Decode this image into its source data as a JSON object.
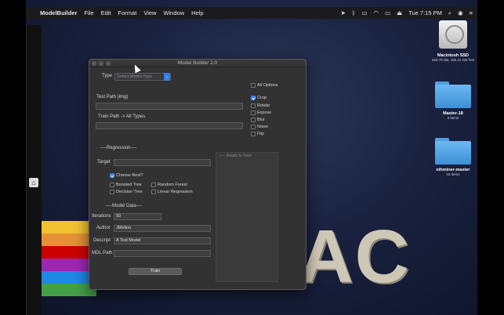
{
  "menubar": {
    "app": "ModelBuilder",
    "items": [
      "File",
      "Edit",
      "Format",
      "View",
      "Window",
      "Help"
    ],
    "clock": "Tue 7:15 PM"
  },
  "desktop": {
    "drive": {
      "label": "Macintosh SSD",
      "sub": "250.79 GB, 165.41 GB free"
    },
    "folders": [
      {
        "label": "Master-18",
        "sub": "5 items"
      },
      {
        "label": "ethminer-master",
        "sub": "16 items"
      }
    ],
    "wallpaper_text": "DMAC",
    "rainbow": [
      "#f1c232",
      "#e69138",
      "#cc0000",
      "#9c27b0",
      "#1e88e5",
      "#43a047"
    ]
  },
  "window": {
    "title": "Model Builder 2.0",
    "type_label": "Type",
    "type_select": "Select Model Type",
    "all_options": "All Options",
    "options": [
      {
        "label": "Crop",
        "checked": true
      },
      {
        "label": "Rotate",
        "checked": false
      },
      {
        "label": "Expose",
        "checked": false
      },
      {
        "label": "Blur",
        "checked": false
      },
      {
        "label": "Noise",
        "checked": false
      },
      {
        "label": "Flip",
        "checked": false
      }
    ],
    "test_path_label": "Test Path (img)",
    "train_path_label": "Train Path -> All Types",
    "regression_header": "----Regression----",
    "target_label": "Target",
    "target_value": "",
    "choose_best": "Choose Best?",
    "boosted_tree": "Boosted Tree",
    "random_forest": "Random Forest",
    "decision_tree": "Decision Tree",
    "linear_regression": "Linear Regression",
    "ready_text": "----- Ready to Train",
    "model_data_header": "----Model Data----",
    "iterations_label": "Iterations",
    "iterations_value": "50",
    "author_label": "Author",
    "author_value": "JMelton",
    "descript_label": "Descript",
    "descript_value": "A Test Model",
    "mdl_path_label": "MDL Path",
    "train_button": "Train"
  }
}
